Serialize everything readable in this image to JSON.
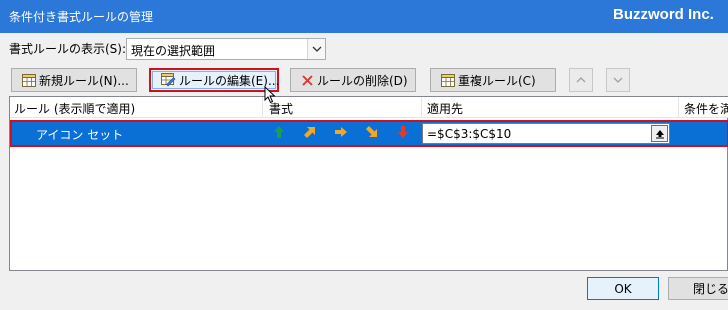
{
  "window": {
    "title": "条件付き書式ルールの管理",
    "brand": "Buzzword Inc."
  },
  "scope": {
    "label": "書式ルールの表示(S):",
    "value": "現在の選択範囲"
  },
  "toolbar": {
    "new_label": "新規ルール(N)...",
    "edit_label": "ルールの編集(E)...",
    "delete_label": "ルールの削除(D)",
    "duplicate_label": "重複ルール(C)"
  },
  "list": {
    "headers": {
      "rule": "ルール (表示順で適用)",
      "format": "書式",
      "applies_to": "適用先",
      "stop_if": "条件を満"
    },
    "rows": [
      {
        "name": "アイコン セット",
        "applies_to": "=$C$3:$C$10",
        "icons": [
          "arrow-up-icon",
          "arrow-up-right-icon",
          "arrow-right-icon",
          "arrow-down-right-icon",
          "arrow-down-icon"
        ]
      }
    ]
  },
  "footer": {
    "ok_label": "OK",
    "close_label": "閉じる"
  },
  "colors": {
    "titlebar": "#2b78d8",
    "selection": "#0b70d5",
    "highlight_outline": "#d0111b",
    "arrow_green": "#1e9e4a",
    "arrow_orange": "#f5a623",
    "arrow_red": "#e53a2a"
  }
}
